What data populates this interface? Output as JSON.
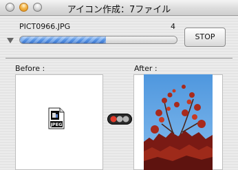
{
  "window": {
    "title": "アイコン作成：7ファイル",
    "controls": [
      "close-icon",
      "minimize-icon",
      "zoom-icon"
    ]
  },
  "progress": {
    "filename": "PICT0966.JPG",
    "count": "4",
    "fraction": 0.55,
    "color": "#4f8ee2"
  },
  "actions": {
    "stop_label": "STOP"
  },
  "panels": {
    "before_label": "Before :",
    "after_label": "After :",
    "before_icon": "jpeg-file-icon",
    "jpeg_badge": "JPEG",
    "status_icon": "progress-arrows-icon",
    "after_image": "autumn-maple-tree-photo"
  }
}
